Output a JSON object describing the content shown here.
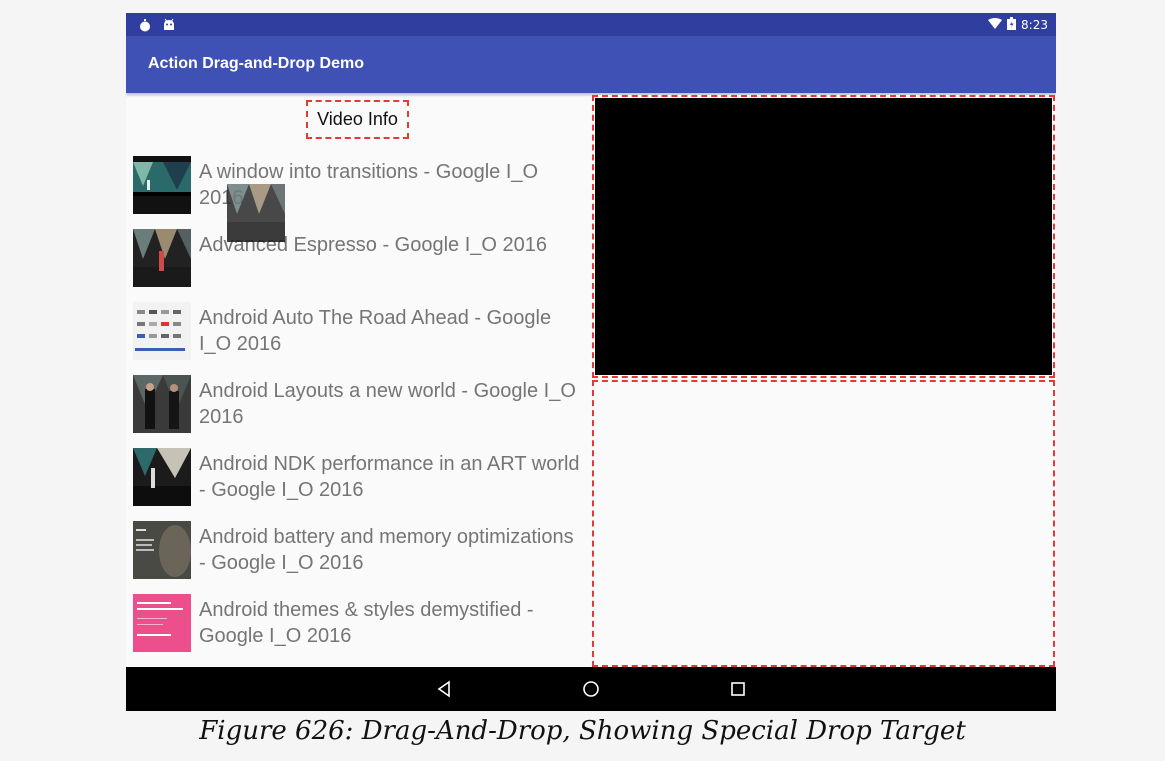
{
  "status_bar": {
    "time": "8:23",
    "left_icons": [
      "notification-icon",
      "android-icon"
    ],
    "right_icons": [
      "wifi-icon",
      "battery-icon"
    ]
  },
  "app": {
    "title": "Action Drag-and-Drop Demo",
    "primary_color": "#3f51b5",
    "status_color": "#303f9f",
    "drop_target_border_color": "#e53935"
  },
  "drop_target": {
    "label": "Video Info"
  },
  "videos": [
    {
      "title": "A window into transitions - Google I_O 2016"
    },
    {
      "title": "Advanced Espresso - Google I_O 2016"
    },
    {
      "title": "Android Auto The Road Ahead - Google I_O 2016"
    },
    {
      "title": "Android Layouts a new world - Google I_O 2016"
    },
    {
      "title": "Android NDK performance in an ART world - Google I_O 2016"
    },
    {
      "title": "Android battery and memory optimizations - Google I_O 2016"
    },
    {
      "title": "Android themes & styles demystified - Google I_O 2016"
    }
  ],
  "nav_bar": {
    "buttons": [
      "back-icon",
      "home-icon",
      "recents-icon"
    ]
  },
  "caption": "Figure 626: Drag-And-Drop, Showing Special Drop Target"
}
